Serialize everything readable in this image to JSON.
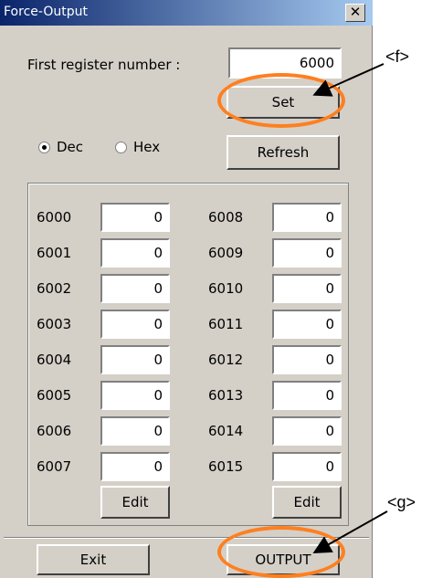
{
  "window": {
    "title": "Force-Output",
    "close_icon_label": "✕"
  },
  "first_register": {
    "label": "First register number :",
    "value": "6000"
  },
  "buttons": {
    "set": "Set",
    "refresh": "Refresh",
    "edit_left": "Edit",
    "edit_right": "Edit",
    "exit": "Exit",
    "output": "OUTPUT"
  },
  "radix": {
    "dec": "Dec",
    "hex": "Hex",
    "selected": "Dec"
  },
  "registers_left": [
    {
      "addr": "6000",
      "value": "0"
    },
    {
      "addr": "6001",
      "value": "0"
    },
    {
      "addr": "6002",
      "value": "0"
    },
    {
      "addr": "6003",
      "value": "0"
    },
    {
      "addr": "6004",
      "value": "0"
    },
    {
      "addr": "6005",
      "value": "0"
    },
    {
      "addr": "6006",
      "value": "0"
    },
    {
      "addr": "6007",
      "value": "0"
    }
  ],
  "registers_right": [
    {
      "addr": "6008",
      "value": "0"
    },
    {
      "addr": "6009",
      "value": "0"
    },
    {
      "addr": "6010",
      "value": "0"
    },
    {
      "addr": "6011",
      "value": "0"
    },
    {
      "addr": "6012",
      "value": "0"
    },
    {
      "addr": "6013",
      "value": "0"
    },
    {
      "addr": "6014",
      "value": "0"
    },
    {
      "addr": "6015",
      "value": "0"
    }
  ],
  "annotations": {
    "f": "<f>",
    "g": "<g>"
  },
  "colors": {
    "highlight": "#ff7f1f",
    "titlebar_start": "#0a246a",
    "titlebar_end": "#a6caf0",
    "face": "#d4d0c8"
  }
}
